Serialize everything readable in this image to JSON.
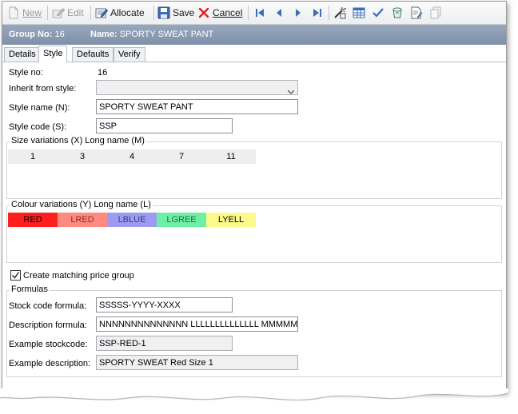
{
  "toolbar": {
    "new_label": "New",
    "edit_label": "Edit",
    "allocate_label": "Allocate",
    "save_label": "Save",
    "cancel_label": "Cancel"
  },
  "header": {
    "group_label": "Group No:",
    "group_value": "16",
    "name_label": "Name:",
    "name_value": "SPORTY SWEAT PANT"
  },
  "tabs": [
    {
      "label": "Details"
    },
    {
      "label": "Style"
    },
    {
      "label": "Defaults"
    },
    {
      "label": "Verify"
    }
  ],
  "form": {
    "style_no_label": "Style no:",
    "style_no_value": "16",
    "inherit_label": "Inherit from style:",
    "inherit_value": "",
    "style_name_label": "Style name (N):",
    "style_name_value": "SPORTY SWEAT PANT",
    "style_code_label": "Style code (S):",
    "style_code_value": "SSP"
  },
  "size_variations": {
    "title": "Size variations (X) Long name (M)",
    "items": [
      "1",
      "3",
      "4",
      "7",
      "11"
    ]
  },
  "colour_variations": {
    "title": "Colour variations (Y) Long name (L)",
    "items": [
      {
        "label": "RED",
        "color": "#ff1f1f"
      },
      {
        "label": "LRED",
        "color": "#ff8a80"
      },
      {
        "label": "LBLUE",
        "color": "#9b9bf3"
      },
      {
        "label": "LGREE",
        "color": "#6cf0a4"
      },
      {
        "label": "LYELL",
        "color": "#fbfb8c"
      }
    ]
  },
  "price_group": {
    "label": "Create matching price group",
    "checked": true
  },
  "formulas": {
    "title": "Formulas",
    "stock_code_label": "Stock code formula:",
    "stock_code_value": "SSSSS-YYYY-XXXX",
    "description_label": "Description formula:",
    "description_value": "NNNNNNNNNNNNNN LLLLLLLLLLLLLL MMMMMMM",
    "example_stock_label": "Example stockcode:",
    "example_stock_value": "SSP-RED-1",
    "example_desc_label": "Example description:",
    "example_desc_value": "SPORTY SWEAT  Red Size 1"
  },
  "colors": {
    "header_bar": "#8797ad",
    "accent_blue": "#3d6db5"
  }
}
